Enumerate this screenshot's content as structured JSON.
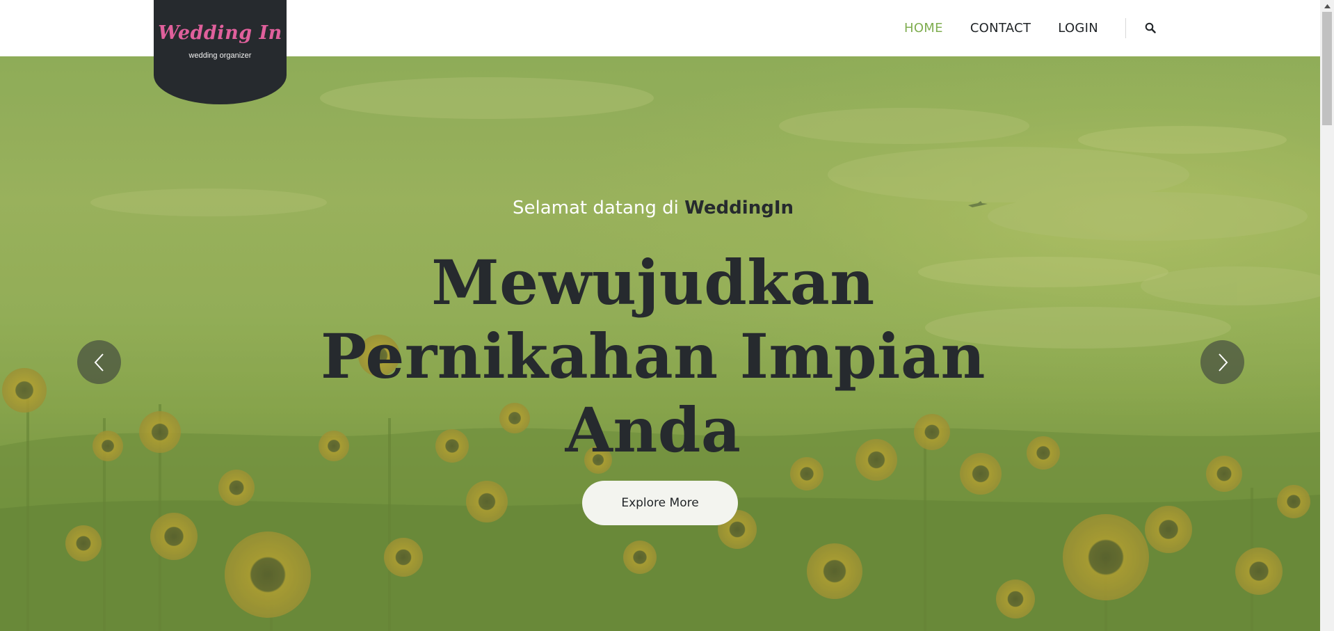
{
  "logo": {
    "title": "Wedding In",
    "subtitle": "wedding organizer"
  },
  "nav": {
    "items": [
      {
        "label": "HOME",
        "active": true
      },
      {
        "label": "CONTACT",
        "active": false
      },
      {
        "label": "LOGIN",
        "active": false
      }
    ],
    "search_icon": "search-icon"
  },
  "hero": {
    "welcome_prefix": "Selamat datang di ",
    "welcome_brand": "WeddingIn",
    "headline_line1": "Mewujudkan",
    "headline_line2": "Pernikahan Impian",
    "headline_line3": "Anda",
    "cta_label": "Explore More",
    "prev_icon": "chevron-left-icon",
    "next_icon": "chevron-right-icon"
  },
  "colors": {
    "accent": "#7fad50",
    "dark": "#262a2e",
    "logo_pink": "#e0609c",
    "overlay_green": "#8eab5a"
  }
}
